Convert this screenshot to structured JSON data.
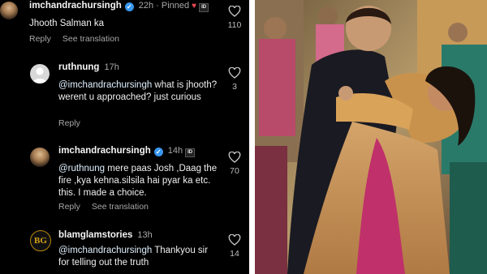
{
  "comments": [
    {
      "username": "imchandrachursingh",
      "meta": "22h · Pinned",
      "text": "Jhooth Salman ka",
      "reply": "Reply",
      "translate": "See translation",
      "likes": "110"
    },
    {
      "username": "ruthnung",
      "meta": "17h",
      "mention": "@imchandrachursingh",
      "text": " what is jhooth?  werent u approached?  just curious",
      "reply": "Reply",
      "likes": "3"
    },
    {
      "username": "imchandrachursingh",
      "meta": "14h",
      "mention": "@ruthnung",
      "text": " mere paas Josh ,Daag the fire ,kya kehna.silsila hai pyar ka etc. this. I made a choice.",
      "reply": "Reply",
      "translate": "See translation",
      "likes": "70"
    },
    {
      "username": "blamglamstories",
      "meta": "13h",
      "avatar_text": "BG",
      "mention": "@imchandrachursingh",
      "text": " Thankyou sir for telling out the truth",
      "likes": "14"
    }
  ],
  "colors": {
    "background": "#000000",
    "verified": "#3897f0",
    "pinned_heart": "#ed4956"
  }
}
